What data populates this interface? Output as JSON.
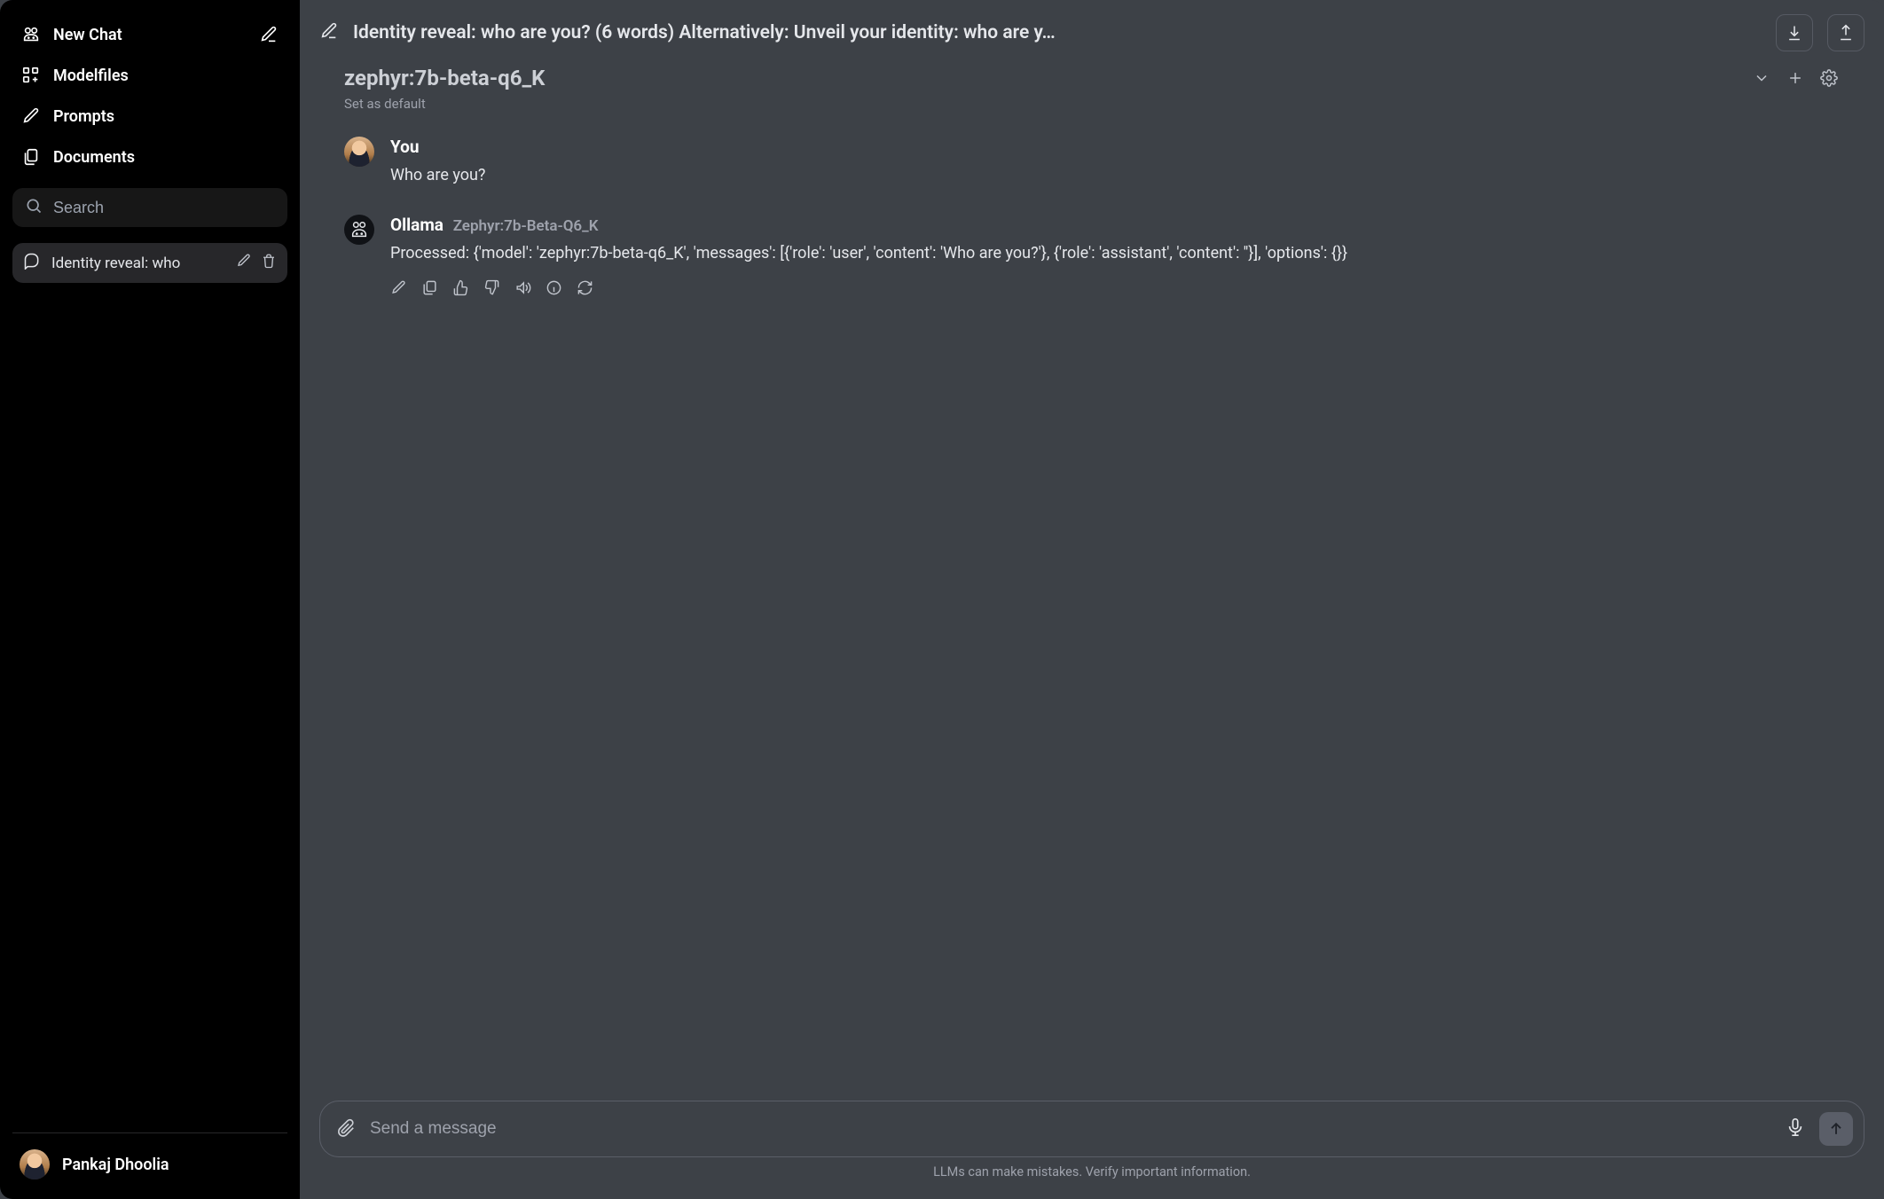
{
  "sidebar": {
    "new_chat": "New Chat",
    "nav": {
      "modelfiles": "Modelfiles",
      "prompts": "Prompts",
      "documents": "Documents"
    },
    "search_placeholder": "Search",
    "chats": [
      {
        "title": "Identity reveal: who"
      }
    ],
    "profile_name": "Pankaj Dhoolia"
  },
  "header": {
    "title": "Identity reveal: who are you? (6 words) Alternatively: Unveil your identity: who are y…"
  },
  "model": {
    "name": "zephyr:7b-beta-q6_K",
    "set_default": "Set as default"
  },
  "messages": {
    "user": {
      "author": "You",
      "text": "Who are you?"
    },
    "assistant": {
      "author": "Ollama",
      "model_tag": "Zephyr:7b-Beta-Q6_K",
      "text": "Processed: {'model': 'zephyr:7b-beta-q6_K', 'messages': [{'role': 'user', 'content': 'Who are you?'}, {'role': 'assistant', 'content': ''}], 'options': {}}"
    }
  },
  "composer": {
    "placeholder": "Send a message"
  },
  "disclaimer": "LLMs can make mistakes. Verify important information."
}
